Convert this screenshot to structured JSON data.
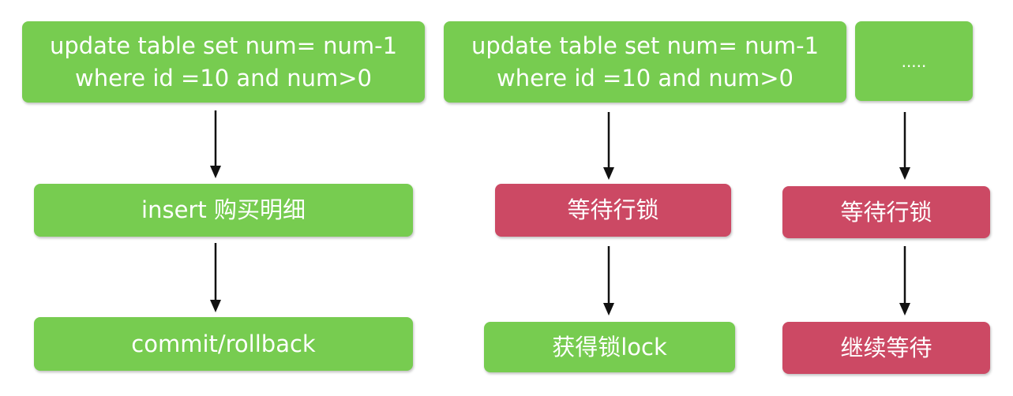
{
  "colors": {
    "green": "#77cc50",
    "red": "#cc4964"
  },
  "columns": [
    {
      "top": {
        "line1": "update table set num= num-1",
        "line2": "where id =10 and num>0"
      },
      "middle": "insert 购买明细",
      "bottom": "commit/rollback"
    },
    {
      "top": {
        "line1": "update table set num= num-1",
        "line2": "where id =10 and num>0"
      },
      "middle": "等待行锁",
      "bottom": "获得锁lock"
    },
    {
      "top": {
        "line1": "....."
      },
      "middle": "等待行锁",
      "bottom": "继续等待"
    }
  ]
}
